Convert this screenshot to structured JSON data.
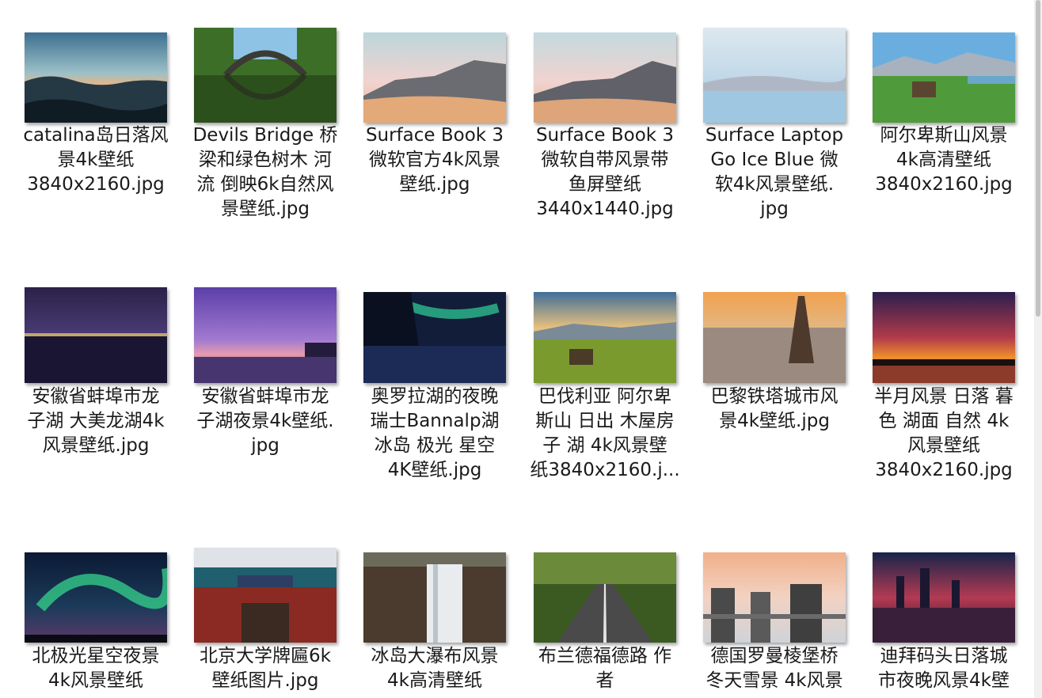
{
  "files": [
    {
      "name": "catalina岛日落风景4k壁纸3840x2160.jpg"
    },
    {
      "name": "Devils Bridge 桥梁和绿色树木 河流 倒映6k自然风景壁纸.jpg"
    },
    {
      "name": "Surface Book 3 微软官方4k风景壁纸.jpg"
    },
    {
      "name": "Surface Book 3 微软自带风景带鱼屏壁纸3440x1440.jpg"
    },
    {
      "name": "Surface Laptop Go Ice Blue 微软4k风景壁纸.jpg"
    },
    {
      "name": "阿尔卑斯山风景4k高清壁纸3840x2160.jpg"
    },
    {
      "name": "安徽省蚌埠市龙子湖 大美龙湖4k风景壁纸.jpg"
    },
    {
      "name": "安徽省蚌埠市龙子湖夜景4k壁纸.jpg"
    },
    {
      "name": "奥罗拉湖的夜晚 瑞士Bannalp湖 冰岛 极光 星空4K壁纸.jpg"
    },
    {
      "name": "巴伐利亚 阿尔卑斯山 日出 木屋房子 湖 4k风景壁纸3840x2160.j..."
    },
    {
      "name": "巴黎铁塔城市风景4k壁纸.jpg"
    },
    {
      "name": "半月风景 日落 暮色 湖面 自然 4k风景壁纸3840x2160.jpg"
    },
    {
      "name": "北极光星空夜景4k风景壁纸"
    },
    {
      "name": "北京大学牌匾6k壁纸图片.jpg"
    },
    {
      "name": "冰岛大瀑布风景4k高清壁纸"
    },
    {
      "name": "布兰德福德路 作者"
    },
    {
      "name": "德国罗曼棱堡桥冬天雪景 4k风景"
    },
    {
      "name": "迪拜码头日落城市夜晚风景4k壁"
    }
  ],
  "labels": [
    [
      "catalina岛日落风",
      "景4k壁纸",
      "3840x2160.jpg"
    ],
    [
      "Devils Bridge 桥",
      "梁和绿色树木 河",
      "流 倒映6k自然风",
      "景壁纸.jpg"
    ],
    [
      "Surface Book 3",
      "微软官方4k风景",
      "壁纸.jpg"
    ],
    [
      "Surface Book 3",
      "微软自带风景带",
      "鱼屏壁纸",
      "3440x1440.jpg"
    ],
    [
      "Surface Laptop",
      "Go Ice Blue 微",
      "软4k风景壁纸.",
      "jpg"
    ],
    [
      "阿尔卑斯山风景",
      "4k高清壁纸",
      "3840x2160.jpg"
    ],
    [
      "安徽省蚌埠市龙",
      "子湖 大美龙湖4k",
      "风景壁纸.jpg"
    ],
    [
      "安徽省蚌埠市龙",
      "子湖夜景4k壁纸.",
      "jpg"
    ],
    [
      "奥罗拉湖的夜晚",
      "瑞士Bannalp湖",
      "冰岛 极光 星空",
      "4K壁纸.jpg"
    ],
    [
      "巴伐利亚 阿尔卑",
      "斯山 日出 木屋房",
      "子 湖 4k风景壁",
      "纸3840x2160.j..."
    ],
    [
      "巴黎铁塔城市风",
      "景4k壁纸.jpg"
    ],
    [
      "半月风景 日落 暮",
      "色 湖面 自然 4k",
      "风景壁纸",
      "3840x2160.jpg"
    ],
    [
      "北极光星空夜景",
      "4k风景壁纸"
    ],
    [
      "北京大学牌匾6k",
      "壁纸图片.jpg"
    ],
    [
      "冰岛大瀑布风景",
      "4k高清壁纸"
    ],
    [
      "布兰德福德路 作",
      "者"
    ],
    [
      "德国罗曼棱堡桥",
      "冬天雪景 4k风景"
    ],
    [
      "迪拜码头日落城",
      "市夜晚风景4k壁"
    ]
  ],
  "colors": {
    "text": "#1a1a1a",
    "background": "#ffffff"
  }
}
